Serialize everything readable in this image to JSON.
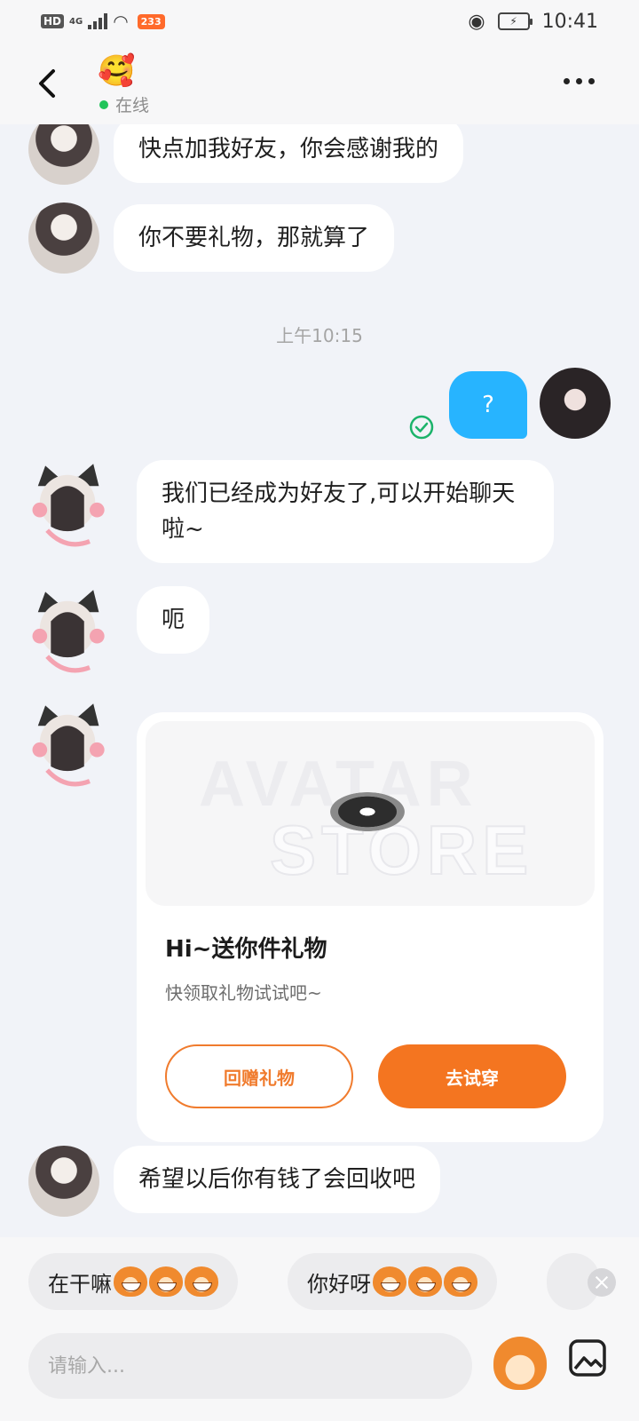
{
  "status_bar": {
    "hd": "HD",
    "network": "4G",
    "badge": "233",
    "time": "10:41"
  },
  "header": {
    "title_emoji": "🥰",
    "online_text": "在线"
  },
  "messages": {
    "m1": "快点加我好友，你会感谢我的",
    "m2": "你不要礼物，那就算了",
    "timestamp": "上午10:15",
    "my_message": "?",
    "m3": "我们已经成为好友了,可以开始聊天啦~",
    "m4": "呃",
    "m5": "希望以后你有钱了会回收吧"
  },
  "gift_card": {
    "watermark_line1": "AVATAR",
    "watermark_line2": "STORE",
    "title": "Hi~送你件礼物",
    "subtitle": "快领取礼物试试吧~",
    "button_return_gift": "回赠礼物",
    "button_try_on": "去试穿"
  },
  "quick_replies": [
    {
      "text": "在干嘛"
    },
    {
      "text": "你好呀"
    }
  ],
  "input": {
    "placeholder": "请输入..."
  },
  "colors": {
    "accent_orange": "#f47520",
    "my_bubble_blue": "#27b4ff",
    "online_green": "#21c45a"
  }
}
